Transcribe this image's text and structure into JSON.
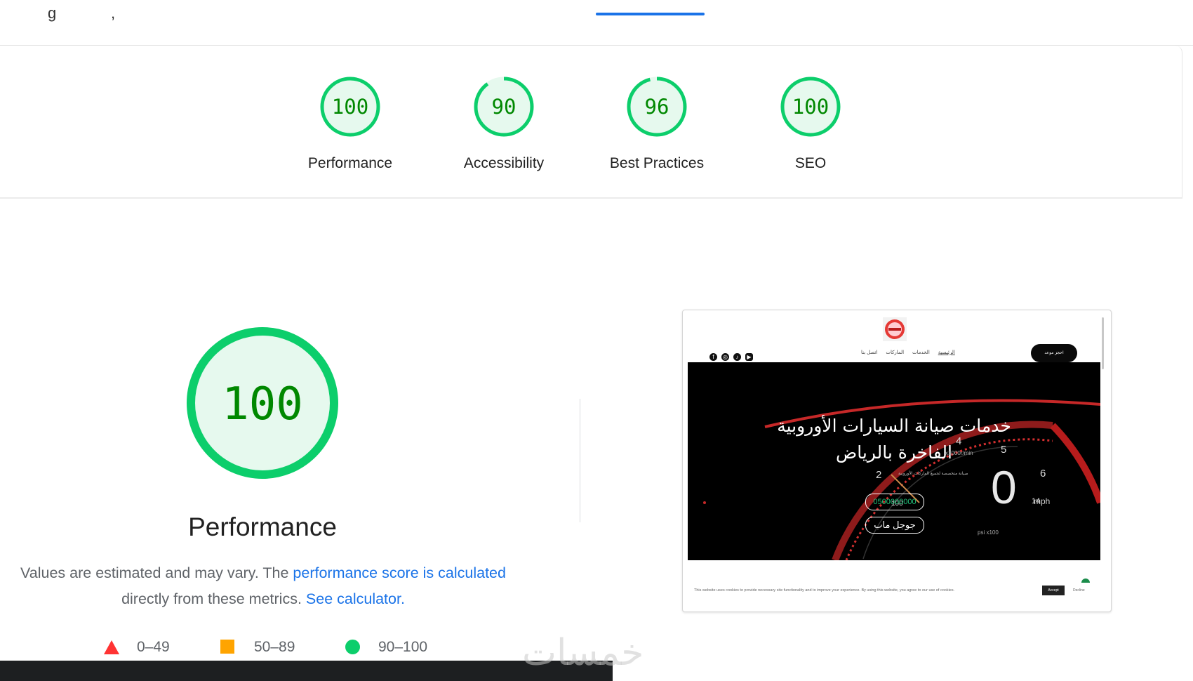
{
  "topbar": {
    "fragments": [
      "g",
      ","
    ]
  },
  "scores": [
    {
      "value": 100,
      "label": "Performance"
    },
    {
      "value": 90,
      "label": "Accessibility"
    },
    {
      "value": 96,
      "label": "Best Practices"
    },
    {
      "value": 100,
      "label": "SEO"
    }
  ],
  "main": {
    "score": 100,
    "title": "Performance",
    "desc_prefix": "Values are estimated and may vary. The ",
    "desc_link1": "performance score is calculated",
    "desc_middle": " directly from these metrics. ",
    "desc_link2": "See calculator."
  },
  "legend": {
    "fail": "0–49",
    "average": "50–89",
    "pass": "90–100"
  },
  "colors": {
    "pass": "#0cce6b",
    "pass_text": "#008800",
    "pass_fill": "#e6f9ee",
    "average": "#ffa400",
    "fail": "#ff3333",
    "link": "#1a73e8"
  },
  "screenshot": {
    "nav_items": [
      "الرئيسية",
      "الخدمات",
      "الماركات",
      "اتصل بنا"
    ],
    "cta": "احجز موعد",
    "hero_title_1": "خدمات صيانة السيارات الأوروبية",
    "hero_title_2": "الفاخرة بالرياض",
    "hero_sub": "صيانة متخصصة لجميع الماركات الأوروبية",
    "phone": "0500000000",
    "maps": "جوجل ماب",
    "speed": "0",
    "mph": "mph",
    "ticks": [
      "2",
      "4",
      "5",
      "6",
      "14",
      "100"
    ],
    "rpm_label": "x1000r/min",
    "psi_label": "psi x100",
    "cookie_text": "This website uses cookies to provide necessary site functionality and to improve your experience. By using this website, you agree to our use of cookies.",
    "accept": "Accept",
    "decline": "Decline"
  },
  "watermark": "خمسات"
}
